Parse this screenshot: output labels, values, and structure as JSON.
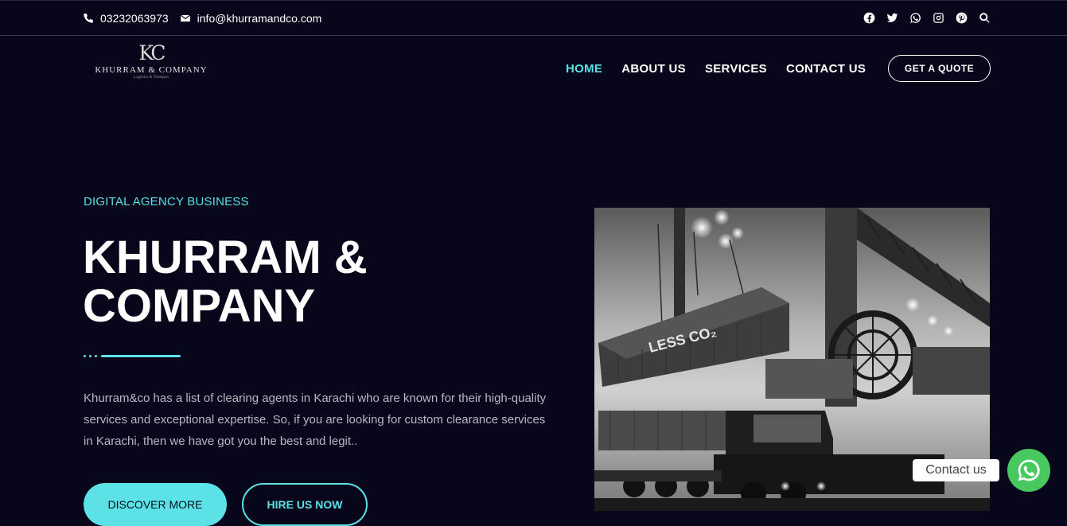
{
  "topbar": {
    "phone": "03232063973",
    "email": "info@khurramandco.com",
    "social_icons": [
      "facebook-icon",
      "twitter-icon",
      "whatsapp-icon",
      "instagram-icon",
      "pinterest-icon",
      "search-icon"
    ]
  },
  "logo": {
    "mark": "KC",
    "name": "KHURRAM & COMPANY",
    "tagline": "Logistics & Transport"
  },
  "nav": {
    "items": [
      {
        "label": "HOME",
        "active": true
      },
      {
        "label": "ABOUT US",
        "active": false
      },
      {
        "label": "SERVICES",
        "active": false
      },
      {
        "label": "CONTACT US",
        "active": false
      }
    ],
    "quote_label": "GET A QUOTE"
  },
  "hero": {
    "eyebrow": "DIGITAL AGENCY BUSINESS",
    "title_line1": "KHURRAM &",
    "title_line2": "COMPANY",
    "description": "Khurram&co has a list of clearing agents in Karachi who are known for their high-quality services and exceptional expertise. So, if you are looking for custom clearance services in Karachi, then we have got you the best and legit..",
    "primary_button": "DISCOVER MORE",
    "secondary_button": "HIRE US NOW",
    "image_text": "LESS CO₂"
  },
  "whatsapp": {
    "label": "Contact us"
  },
  "colors": {
    "accent": "#5ce1e6",
    "background": "#07061a",
    "whatsapp_green": "#47c960"
  }
}
